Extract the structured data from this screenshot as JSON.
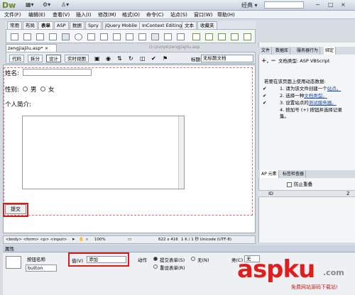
{
  "app": {
    "logo": "Dw",
    "workspace": "经典",
    "window_controls": [
      "−",
      "□",
      "×"
    ]
  },
  "menu": [
    "文件(F)",
    "编辑(E)",
    "查看(V)",
    "插入(I)",
    "修改(M)",
    "格式(O)",
    "命令(C)",
    "站点(S)",
    "窗口(W)",
    "帮助(H)"
  ],
  "insert_tabs": [
    "常用",
    "布局",
    "表单",
    "ASP",
    "数据",
    "Spry",
    "jQuery Mobile",
    "InContext Editing",
    "文本",
    "收藏夹"
  ],
  "insert_active": "表单",
  "document": {
    "tab": "zengjiajilu.asp*",
    "path": "G:\\zuoye\\zengjiajilu.asp"
  },
  "doc_toolbar": {
    "code": "代码",
    "split": "拆分",
    "design": "设计",
    "live": "实时视图",
    "title_label": "标题:",
    "title_value": "无标题文档"
  },
  "form": {
    "name_label": "姓名:",
    "gender_label": "性别:",
    "male": "男",
    "female": "女",
    "intro_label": "个人简介:",
    "submit": "提交"
  },
  "status": {
    "tags": "<body> <form> <p> <input>",
    "zoom": "100%",
    "size": "622 x 416",
    "info": "1 K / 1 秒  Unicode (UTF-8)"
  },
  "properties": {
    "header": "属性",
    "button_name_label": "按钮名称",
    "button_name_value": "button",
    "value_label": "值(V)",
    "value_value": "添加",
    "action_label": "动作",
    "action_submit": "提交表单(S)",
    "action_none": "无(N)",
    "action_reset": "重设表单(R)",
    "class_label": "类(C)",
    "class_value": "无"
  },
  "right_panel": {
    "tabs": [
      "文件",
      "数据库",
      "服务器行为",
      "绑定"
    ],
    "active_tab": "绑定",
    "doc_type_label": "文档类型: ASP VBScript",
    "intro": "若要在该页面上使用动态数据:",
    "steps": [
      {
        "num": "1.",
        "text": "请为该文件创建一个",
        "link": "站点。"
      },
      {
        "num": "2.",
        "text": "选择一种",
        "link": "文档类型。"
      },
      {
        "num": "3.",
        "text": "设置站点的",
        "link": "测试服务器。"
      },
      {
        "num": "4.",
        "text": "按加号 (+) 按钮并选择记录集。",
        "link": ""
      }
    ],
    "ap_tabs": [
      "AP 元素",
      "标签检查器"
    ],
    "prevent_overlap": "防止重叠",
    "ap_columns": [
      "ID",
      "Z"
    ]
  },
  "watermark": {
    "main": "aspku",
    "suffix": ".com",
    "sub": "免费网站源码下载站!"
  }
}
